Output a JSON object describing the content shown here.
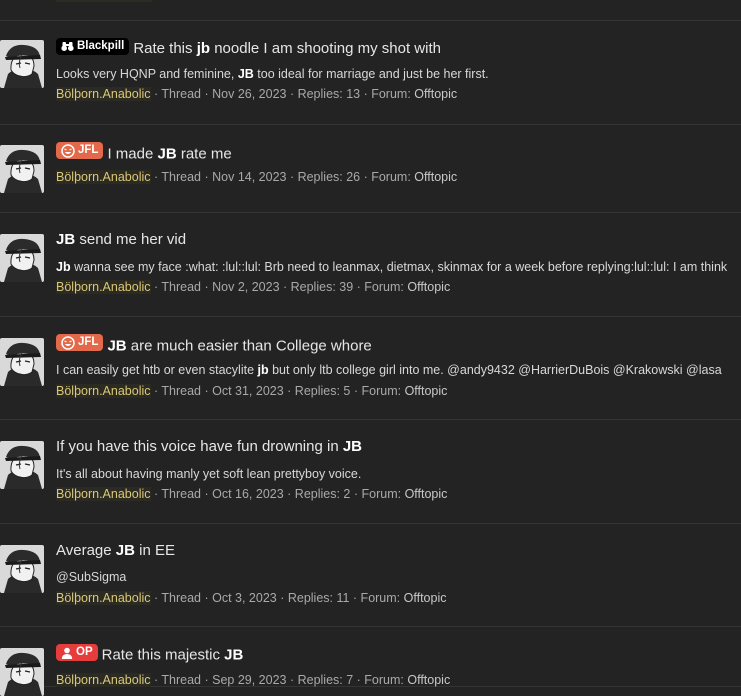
{
  "results": [
    {
      "label": {
        "text": "Blackpill",
        "icon": "binoculars-icon",
        "color": "#000000"
      },
      "title": [
        {
          "t": "Rate this "
        },
        {
          "t": "jb",
          "b": true
        },
        {
          "t": " noodle I am shooting my shot with"
        }
      ],
      "snippet": [
        {
          "t": "Looks very HQNP and feminine, "
        },
        {
          "t": "JB",
          "b": true
        },
        {
          "t": " too ideal for marriage and just be her first."
        }
      ],
      "author": "Bölþorn.Anabolic",
      "meta": " · Thread · Nov 26, 2023 · Replies: 13 · Forum: ",
      "forum": "Offtopic"
    },
    {
      "label": {
        "text": "JFL",
        "icon": "laughing-face-icon",
        "color": "#e26a4a"
      },
      "title": [
        {
          "t": "I made "
        },
        {
          "t": "JB",
          "b": true
        },
        {
          "t": " rate me"
        }
      ],
      "snippet": [],
      "author": "Bölþorn.Anabolic",
      "meta": " · Thread · Nov 14, 2023 · Replies: 26 · Forum: ",
      "forum": "Offtopic"
    },
    {
      "label": null,
      "title": [
        {
          "t": "JB",
          "b": true
        },
        {
          "t": " send me her vid"
        }
      ],
      "snippet": [
        {
          "t": "Jb",
          "b": true
        },
        {
          "t": " wanna see my face :what: :lul::lul: Brb need to leanmax, dietmax, skinmax for a week before replying:lul::lul: I am think"
        }
      ],
      "author": "Bölþorn.Anabolic",
      "meta": " · Thread · Nov 2, 2023 · Replies: 39 · Forum: ",
      "forum": "Offtopic"
    },
    {
      "label": {
        "text": "JFL",
        "icon": "laughing-face-icon",
        "color": "#e26a4a"
      },
      "title": [
        {
          "t": "JB",
          "b": true
        },
        {
          "t": " are much easier than College whore"
        }
      ],
      "snippet": [
        {
          "t": "I can easily get htb or even stacylite "
        },
        {
          "t": "jb",
          "b": true
        },
        {
          "t": " but only ltb college girl into me. @andy9432 @HarrierDuBois @Krakowski @lasa"
        }
      ],
      "author": "Bölþorn.Anabolic",
      "meta": " · Thread · Oct 31, 2023 · Replies: 5 · Forum: ",
      "forum": "Offtopic"
    },
    {
      "label": null,
      "title": [
        {
          "t": "If you have this voice have fun drowning in "
        },
        {
          "t": "JB",
          "b": true
        }
      ],
      "snippet": [
        {
          "t": "It's all about having manly yet soft lean prettyboy voice."
        }
      ],
      "author": "Bölþorn.Anabolic",
      "meta": " · Thread · Oct 16, 2023 · Replies: 2 · Forum: ",
      "forum": "Offtopic"
    },
    {
      "label": null,
      "title": [
        {
          "t": "Average "
        },
        {
          "t": "JB",
          "b": true
        },
        {
          "t": " in EE"
        }
      ],
      "snippet": [
        {
          "t": "@SubSigma"
        }
      ],
      "author": "Bölþorn.Anabolic",
      "meta": " · Thread · Oct 3, 2023 · Replies: 11 · Forum: ",
      "forum": "Offtopic"
    },
    {
      "label": {
        "text": "OP",
        "icon": "user-icon",
        "color": "#e53c3c"
      },
      "title": [
        {
          "t": "Rate this majestic "
        },
        {
          "t": "JB",
          "b": true
        }
      ],
      "snippet": [],
      "author": "Bölþorn.Anabolic",
      "meta": " · Thread · Sep 29, 2023 · Replies: 7 · Forum: ",
      "forum": "Offtopic"
    }
  ]
}
